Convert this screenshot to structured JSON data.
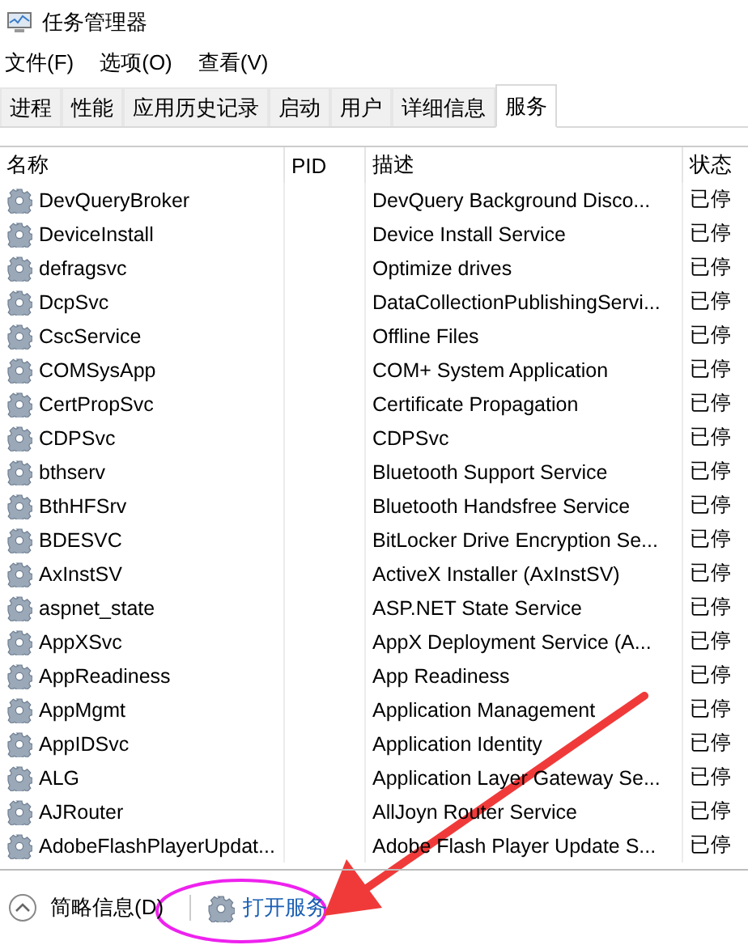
{
  "window": {
    "title": "任务管理器"
  },
  "menu": [
    "文件(F)",
    "选项(O)",
    "查看(V)"
  ],
  "tabs": [
    {
      "label": "进程",
      "selected": false
    },
    {
      "label": "性能",
      "selected": false
    },
    {
      "label": "应用历史记录",
      "selected": false
    },
    {
      "label": "启动",
      "selected": false
    },
    {
      "label": "用户",
      "selected": false
    },
    {
      "label": "详细信息",
      "selected": false
    },
    {
      "label": "服务",
      "selected": true
    }
  ],
  "table": {
    "columns": [
      "名称",
      "PID",
      "描述",
      "状态"
    ],
    "rows": [
      {
        "name": "DevQueryBroker",
        "description": "DevQuery Background Disco...",
        "status": "已停"
      },
      {
        "name": "DeviceInstall",
        "description": "Device Install Service",
        "status": "已停"
      },
      {
        "name": "defragsvc",
        "description": "Optimize drives",
        "status": "已停"
      },
      {
        "name": "DcpSvc",
        "description": "DataCollectionPublishingServi...",
        "status": "已停"
      },
      {
        "name": "CscService",
        "description": "Offline Files",
        "status": "已停"
      },
      {
        "name": "COMSysApp",
        "description": "COM+ System Application",
        "status": "已停"
      },
      {
        "name": "CertPropSvc",
        "description": "Certificate Propagation",
        "status": "已停"
      },
      {
        "name": "CDPSvc",
        "description": "CDPSvc",
        "status": "已停"
      },
      {
        "name": "bthserv",
        "description": "Bluetooth Support Service",
        "status": "已停"
      },
      {
        "name": "BthHFSrv",
        "description": "Bluetooth Handsfree Service",
        "status": "已停"
      },
      {
        "name": "BDESVC",
        "description": "BitLocker Drive Encryption Se...",
        "status": "已停"
      },
      {
        "name": "AxInstSV",
        "description": "ActiveX Installer (AxInstSV)",
        "status": "已停"
      },
      {
        "name": "aspnet_state",
        "description": "ASP.NET State Service",
        "status": "已停"
      },
      {
        "name": "AppXSvc",
        "description": "AppX Deployment Service (A...",
        "status": "已停"
      },
      {
        "name": "AppReadiness",
        "description": "App Readiness",
        "status": "已停"
      },
      {
        "name": "AppMgmt",
        "description": "Application Management",
        "status": "已停"
      },
      {
        "name": "AppIDSvc",
        "description": "Application Identity",
        "status": "已停"
      },
      {
        "name": "ALG",
        "description": "Application Layer Gateway Se...",
        "status": "已停"
      },
      {
        "name": "AJRouter",
        "description": "AllJoyn Router Service",
        "status": "已停"
      },
      {
        "name": "AdobeFlashPlayerUpdat...",
        "description": "Adobe Flash Player Update S...",
        "status": "已停"
      }
    ]
  },
  "footer": {
    "details_toggle": "简略信息(D)",
    "open_services_link": "打开服务"
  }
}
